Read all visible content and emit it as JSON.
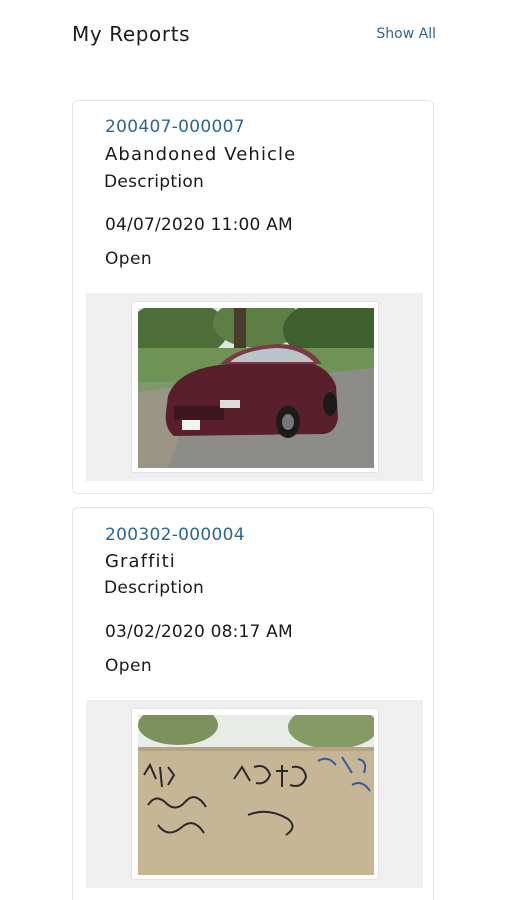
{
  "header": {
    "title": "My Reports",
    "show_all_label": "Show All"
  },
  "reports": [
    {
      "id": "200407-000007",
      "type": "Abandoned Vehicle",
      "description_label": "Description",
      "datetime": "04/07/2020 11:00 AM",
      "status": "Open",
      "photo": "abandoned-vehicle-photo"
    },
    {
      "id": "200302-000004",
      "type": "Graffiti",
      "description_label": "Description",
      "datetime": "03/02/2020 08:17 AM",
      "status": "Open",
      "photo": "graffiti-wall-photo"
    }
  ],
  "colors": {
    "accent": "#2d6690",
    "card_border": "#e4e4e4",
    "photo_band": "#efefef"
  }
}
